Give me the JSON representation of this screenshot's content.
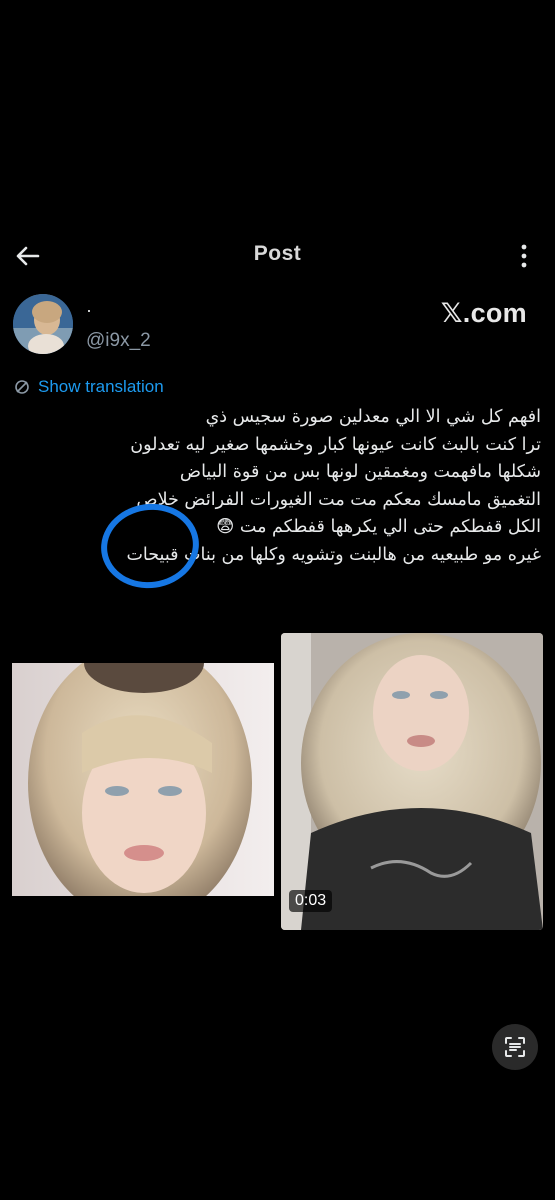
{
  "header": {
    "title": "Post",
    "back_icon": "arrow-left-icon",
    "more_icon": "more-vertical-icon"
  },
  "author": {
    "display_name": "·",
    "handle": "@i9x_2"
  },
  "watermark": "𝕏.com",
  "translation": {
    "label": "Show translation",
    "icon": "translate-icon"
  },
  "tweet": {
    "lines": [
      "افهم كل شي الا الي معدلين صورة سجيس ذي",
      "ترا كنت بالبث كانت عيونها كبار وخشمها صغير ليه تعدلون",
      "شكلها مافهمت ومغمقين لونها بس من قوة البياض",
      "التغميق مامسك معكم مت مت الغيورات الفرائض خلاص",
      "الكل قفطكم حتى الي يكرهها قفطكم مت 😨",
      "غيره مو طبيعيه من هالبنت وتشويه وكلها من بنات قبيحات"
    ]
  },
  "media": {
    "right_video_time": "0:03"
  },
  "floating": {
    "scan_icon": "text-scan-icon"
  },
  "colors": {
    "background": "#000000",
    "link": "#1d9bf0",
    "annotation_circle": "#1677e4"
  }
}
